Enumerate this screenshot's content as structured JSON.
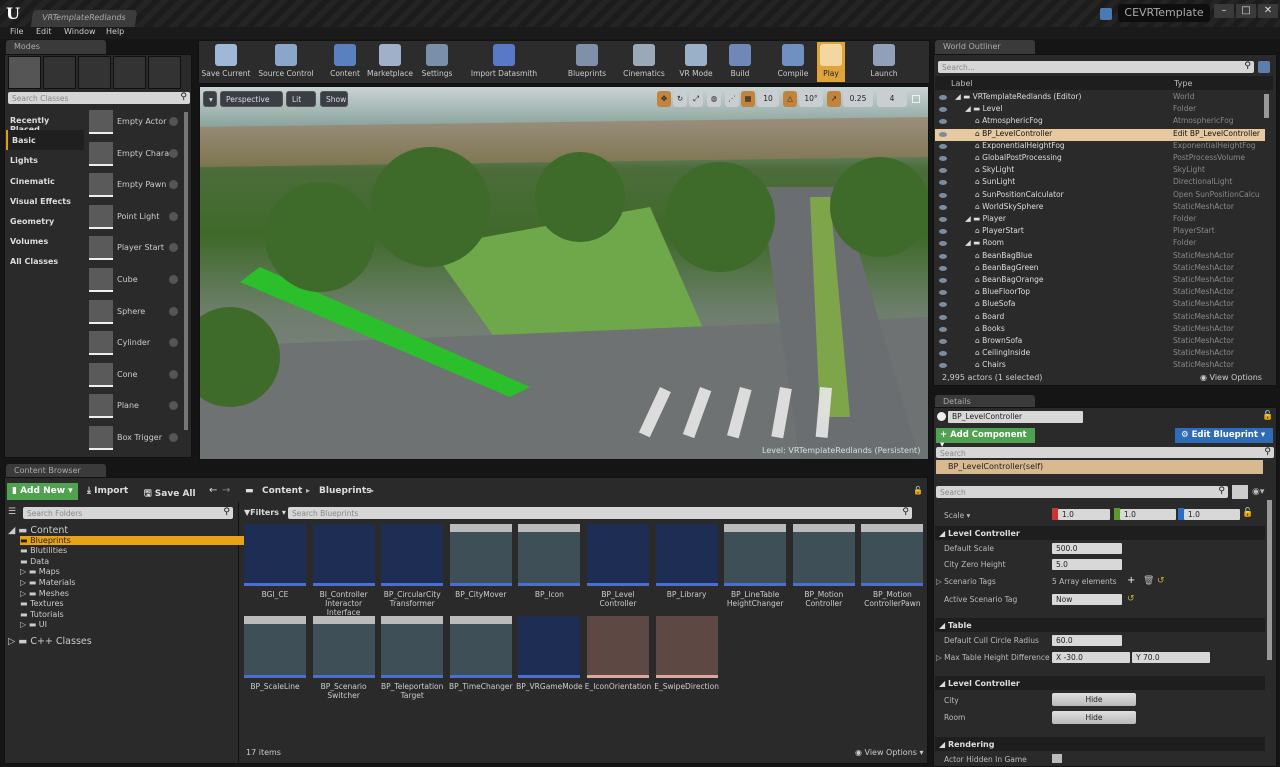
{
  "window": {
    "doc_tab": "VRTemplateRedlands",
    "project": "CEVRTemplate",
    "controls": [
      "–",
      "□",
      "✕"
    ]
  },
  "menu": [
    "File",
    "Edit",
    "Window",
    "Help"
  ],
  "modes": {
    "tab": "Modes",
    "search_placeholder": "Search Classes",
    "categories": [
      "Recently Placed",
      "Basic",
      "Lights",
      "Cinematic",
      "Visual Effects",
      "Geometry",
      "Volumes",
      "All Classes"
    ],
    "active_category": "Basic",
    "items": [
      "Empty Actor",
      "Empty Chara",
      "Empty Pawn",
      "Point Light",
      "Player Start",
      "Cube",
      "Sphere",
      "Cylinder",
      "Cone",
      "Plane",
      "Box Trigger"
    ]
  },
  "toolbar": [
    {
      "label": "Save Current",
      "icon": "save-icon",
      "color": "#9fb8d8"
    },
    {
      "label": "Source Control",
      "icon": "source-control-icon",
      "color": "#8aa6c8"
    },
    {
      "label": "Content",
      "icon": "content-icon",
      "color": "#5a80c0"
    },
    {
      "label": "Marketplace",
      "icon": "marketplace-icon",
      "color": "#a0b0c8"
    },
    {
      "label": "Settings",
      "icon": "settings-icon",
      "color": "#7a8fa8"
    },
    {
      "label": "Import Datasmith",
      "icon": "datasmith-icon",
      "color": "#5a78c8"
    },
    {
      "label": "Blueprints",
      "icon": "blueprints-icon",
      "color": "#8090a8"
    },
    {
      "label": "Cinematics",
      "icon": "cinematics-icon",
      "color": "#9aa8b8"
    },
    {
      "label": "VR Mode",
      "icon": "vr-mode-icon",
      "color": "#9ab0c8"
    },
    {
      "label": "Build",
      "icon": "build-icon",
      "color": "#6f88b8"
    },
    {
      "label": "Compile",
      "icon": "compile-icon",
      "color": "#6f90c0"
    },
    {
      "label": "Play",
      "icon": "play-icon",
      "color": "#f3d6a0"
    },
    {
      "label": "Launch",
      "icon": "launch-icon",
      "color": "#8fa0b8"
    }
  ],
  "viewport": {
    "perspective": "Perspective",
    "lit": "Lit",
    "show": "Show",
    "grid_snap": "10",
    "rotation_snap": "10°",
    "scale_snap": "0.25",
    "camera_speed": "4",
    "level_label": "Level:  VRTemplateRedlands (Persistent)"
  },
  "outliner": {
    "tab": "World Outliner",
    "search_placeholder": "Search...",
    "col_label": "Label",
    "col_type": "Type",
    "rows": [
      {
        "name": "VRTemplateRedlands (Editor)",
        "type": "World",
        "indent": 0
      },
      {
        "name": "Level",
        "type": "Folder",
        "indent": 1
      },
      {
        "name": "AtmosphericFog",
        "type": "AtmosphericFog",
        "indent": 2
      },
      {
        "name": "BP_LevelController",
        "type": "Edit BP_LevelController",
        "indent": 2,
        "selected": true
      },
      {
        "name": "ExponentialHeightFog",
        "type": "ExponentialHeightFog",
        "indent": 2
      },
      {
        "name": "GlobalPostProcessing",
        "type": "PostProcessVolume",
        "indent": 2
      },
      {
        "name": "SkyLight",
        "type": "SkyLight",
        "indent": 2
      },
      {
        "name": "SunLight",
        "type": "DirectionalLight",
        "indent": 2
      },
      {
        "name": "SunPositionCalculator",
        "type": "Open SunPositionCalcu",
        "indent": 2
      },
      {
        "name": "WorldSkySphere",
        "type": "StaticMeshActor",
        "indent": 2
      },
      {
        "name": "Player",
        "type": "Folder",
        "indent": 1
      },
      {
        "name": "PlayerStart",
        "type": "PlayerStart",
        "indent": 2
      },
      {
        "name": "Room",
        "type": "Folder",
        "indent": 1
      },
      {
        "name": "BeanBagBlue",
        "type": "StaticMeshActor",
        "indent": 2
      },
      {
        "name": "BeanBagGreen",
        "type": "StaticMeshActor",
        "indent": 2
      },
      {
        "name": "BeanBagOrange",
        "type": "StaticMeshActor",
        "indent": 2
      },
      {
        "name": "BlueFloorTop",
        "type": "StaticMeshActor",
        "indent": 2
      },
      {
        "name": "BlueSofa",
        "type": "StaticMeshActor",
        "indent": 2
      },
      {
        "name": "Board",
        "type": "StaticMeshActor",
        "indent": 2
      },
      {
        "name": "Books",
        "type": "StaticMeshActor",
        "indent": 2
      },
      {
        "name": "BrownSofa",
        "type": "StaticMeshActor",
        "indent": 2
      },
      {
        "name": "CeilingInside",
        "type": "StaticMeshActor",
        "indent": 2
      },
      {
        "name": "Chairs",
        "type": "StaticMeshActor",
        "indent": 2
      }
    ],
    "status": "2,995 actors (1 selected)",
    "view_options": "View Options"
  },
  "details": {
    "tab": "Details",
    "name_value": "BP_LevelController",
    "add_component": "+ Add Component ▾",
    "edit_blueprint": "⚙ Edit Blueprint ▾",
    "component_search": "Search",
    "self_component": "BP_LevelController(self)",
    "property_search": "Search",
    "scale_label": "Scale ▾",
    "scale": {
      "x": "1.0",
      "y": "1.0",
      "z": "1.0"
    },
    "sections": {
      "level_controller": "Level Controller",
      "table": "Table",
      "level_controller_2": "Level Controller",
      "rendering": "Rendering"
    },
    "default_scale_label": "Default Scale",
    "default_scale": "500.0",
    "city_zero_height_label": "City Zero Height",
    "city_zero_height": "5.0",
    "scenario_tags_label": "Scenario Tags",
    "scenario_tags": "5 Array elements",
    "active_scenario_tag_label": "Active Scenario Tag",
    "active_scenario_tag": "Now",
    "cull_radius_label": "Default Cull Circle Radius",
    "cull_radius": "60.0",
    "max_table_label": "Max Table Height Difference",
    "max_table_x": "X  -30.0",
    "max_table_y": "Y  70.0",
    "city_label": "City",
    "room_label": "Room",
    "hide": "Hide",
    "actor_hidden_label": "Actor Hidden In Game"
  },
  "content_browser": {
    "tab": "Content Browser",
    "add_new": "Add New ▾",
    "import": "⤓ Import",
    "save_all": "🖫 Save All",
    "path": [
      "Content",
      "Blueprints"
    ],
    "search_folders": "Search Folders",
    "filters": "Filters ▾",
    "search_assets": "Search Blueprints",
    "tree": [
      {
        "name": "Content",
        "indent": 0,
        "expanded": true
      },
      {
        "name": "Blueprints",
        "indent": 1,
        "selected": true
      },
      {
        "name": "Blutilities",
        "indent": 1
      },
      {
        "name": "Data",
        "indent": 1
      },
      {
        "name": "Maps",
        "indent": 1,
        "expandable": true
      },
      {
        "name": "Materials",
        "indent": 1,
        "expandable": true
      },
      {
        "name": "Meshes",
        "indent": 1,
        "expandable": true
      },
      {
        "name": "Textures",
        "indent": 1
      },
      {
        "name": "Tutorials",
        "indent": 1
      },
      {
        "name": "UI",
        "indent": 1,
        "expandable": true
      },
      {
        "name": "C++ Classes",
        "indent": 0,
        "expandable": true
      }
    ],
    "assets": [
      {
        "name": "BGI_CE",
        "kind": "bp"
      },
      {
        "name": "BI_Controller Interactor Interface",
        "kind": "bp"
      },
      {
        "name": "BP_CircularCity Transformer",
        "kind": "bp"
      },
      {
        "name": "BP_CityMover",
        "kind": "scene"
      },
      {
        "name": "BP_Icon",
        "kind": "scene"
      },
      {
        "name": "BP_Level Controller",
        "kind": "bp"
      },
      {
        "name": "BP_Library",
        "kind": "bp"
      },
      {
        "name": "BP_LineTable HeightChanger",
        "kind": "scene"
      },
      {
        "name": "BP_Motion Controller",
        "kind": "scene"
      },
      {
        "name": "BP_Motion ControllerPawn",
        "kind": "scene"
      },
      {
        "name": "BP_ScaleLine",
        "kind": "scene"
      },
      {
        "name": "BP_Scenario Switcher",
        "kind": "scene"
      },
      {
        "name": "BP_Teleportation Target",
        "kind": "scene"
      },
      {
        "name": "BP_TimeChanger",
        "kind": "scene"
      },
      {
        "name": "BP_VRGameMode",
        "kind": "bp"
      },
      {
        "name": "E_IconOrientation",
        "kind": "enum"
      },
      {
        "name": "E_SwipeDirection",
        "kind": "enum"
      }
    ],
    "item_count": "17 items",
    "view_options": "View Options ▾"
  }
}
